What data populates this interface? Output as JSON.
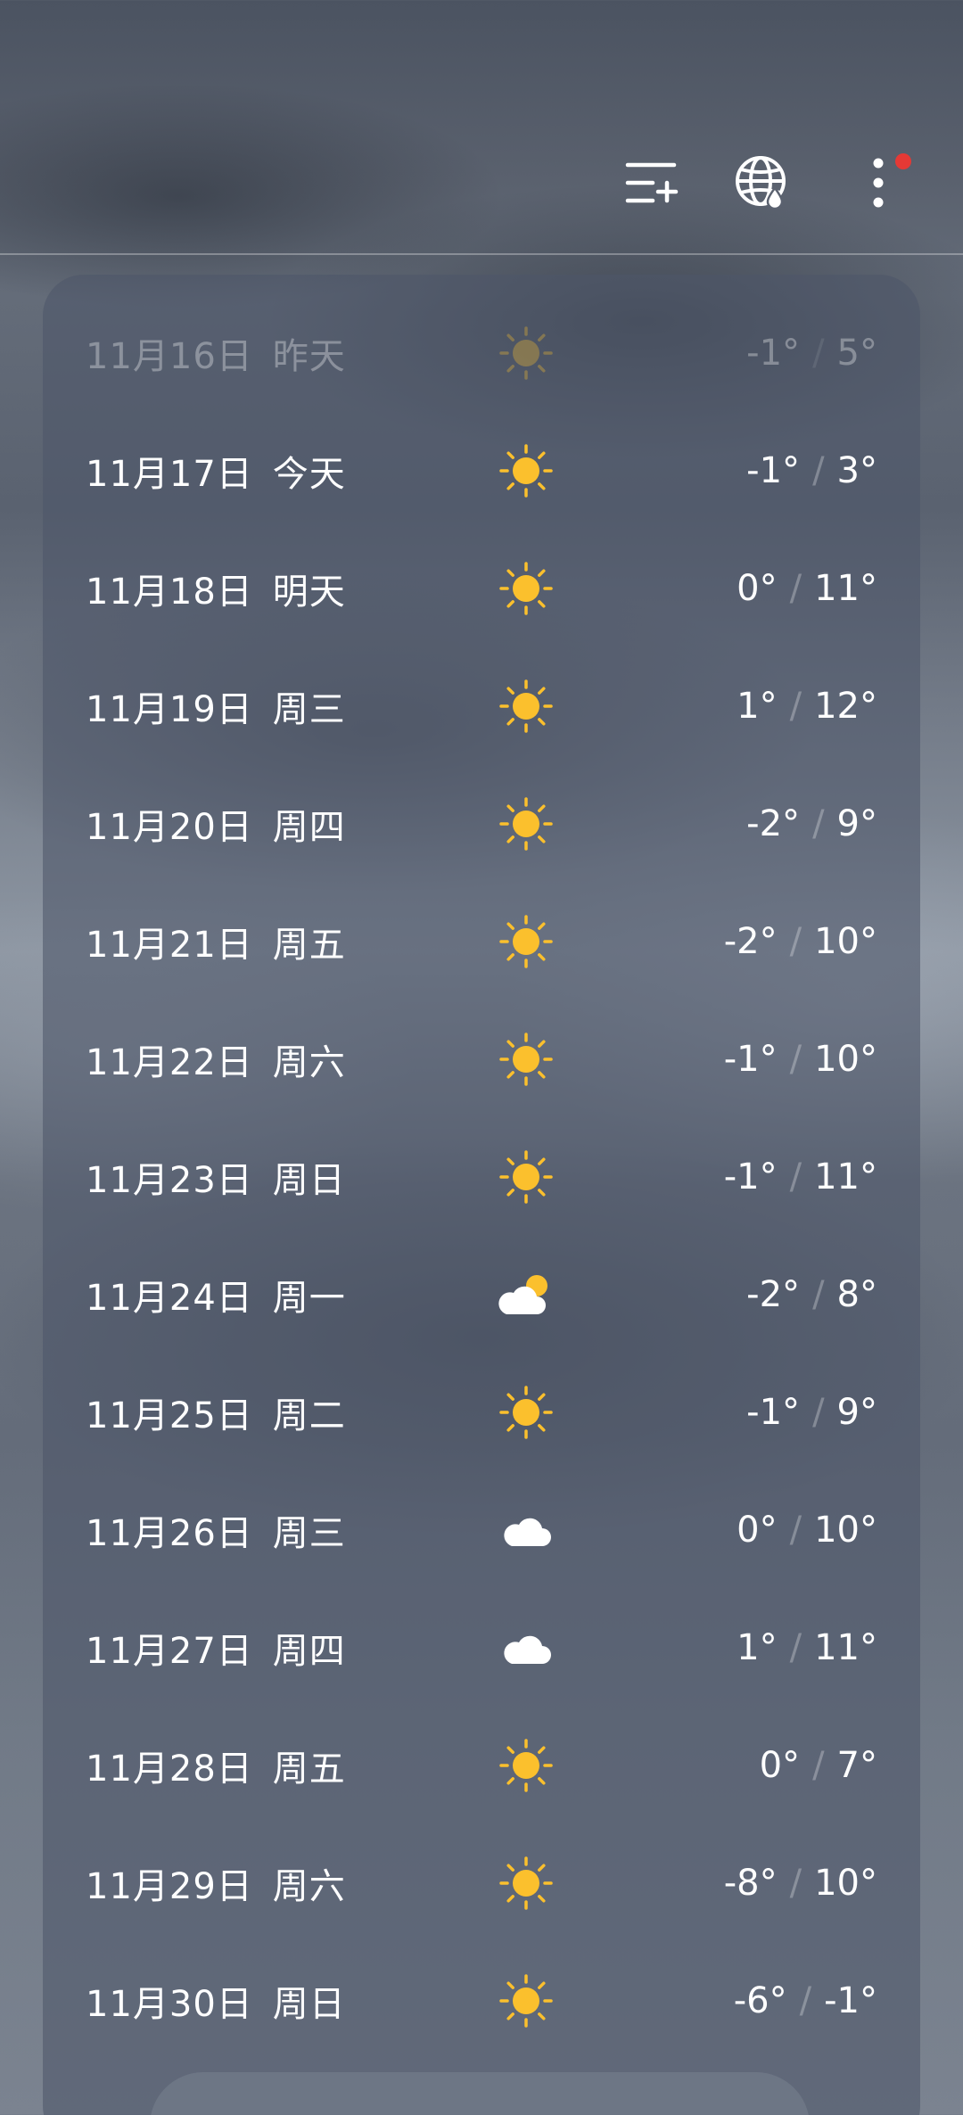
{
  "header": {
    "city": "",
    "add_city_icon": "list-add-icon",
    "globe_icon": "globe-droplet-icon",
    "more_icon": "more-vert-icon",
    "notification_dot_color": "#e53935"
  },
  "forecast": [
    {
      "date": "11月16日",
      "day": "昨天",
      "weather": "sunny",
      "low": "-1°",
      "high": "5°",
      "past": true
    },
    {
      "date": "11月17日",
      "day": "今天",
      "weather": "sunny",
      "low": "-1°",
      "high": "3°"
    },
    {
      "date": "11月18日",
      "day": "明天",
      "weather": "sunny",
      "low": "0°",
      "high": "11°"
    },
    {
      "date": "11月19日",
      "day": "周三",
      "weather": "sunny",
      "low": "1°",
      "high": "12°"
    },
    {
      "date": "11月20日",
      "day": "周四",
      "weather": "sunny",
      "low": "-2°",
      "high": "9°"
    },
    {
      "date": "11月21日",
      "day": "周五",
      "weather": "sunny",
      "low": "-2°",
      "high": "10°"
    },
    {
      "date": "11月22日",
      "day": "周六",
      "weather": "sunny",
      "low": "-1°",
      "high": "10°"
    },
    {
      "date": "11月23日",
      "day": "周日",
      "weather": "sunny",
      "low": "-1°",
      "high": "11°"
    },
    {
      "date": "11月24日",
      "day": "周一",
      "weather": "partly-cloudy",
      "low": "-2°",
      "high": "8°"
    },
    {
      "date": "11月25日",
      "day": "周二",
      "weather": "sunny",
      "low": "-1°",
      "high": "9°"
    },
    {
      "date": "11月26日",
      "day": "周三",
      "weather": "cloudy",
      "low": "0°",
      "high": "10°"
    },
    {
      "date": "11月27日",
      "day": "周四",
      "weather": "cloudy",
      "low": "1°",
      "high": "11°"
    },
    {
      "date": "11月28日",
      "day": "周五",
      "weather": "sunny",
      "low": "0°",
      "high": "7°"
    },
    {
      "date": "11月29日",
      "day": "周六",
      "weather": "sunny",
      "low": "-8°",
      "high": "10°"
    },
    {
      "date": "11月30日",
      "day": "周日",
      "weather": "sunny",
      "low": "-6°",
      "high": "-1°"
    }
  ],
  "temp_separator": "/",
  "colors": {
    "sun": "#FBC02D",
    "cloud": "#FFFFFF"
  }
}
